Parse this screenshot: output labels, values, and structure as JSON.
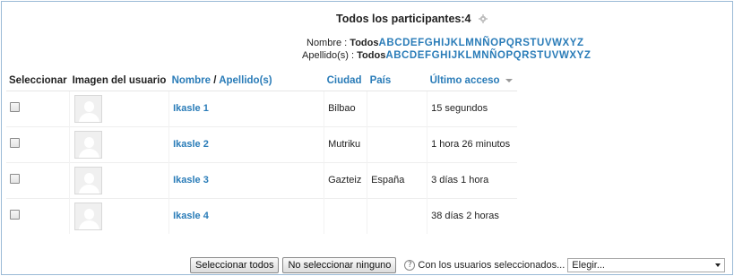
{
  "title": {
    "text": "Todos los participantes:",
    "count": "4"
  },
  "filters": {
    "nombre_label": "Nombre : ",
    "apellido_label": "Apellido(s) : ",
    "todos": "Todos",
    "letters": [
      "A",
      "B",
      "C",
      "D",
      "E",
      "F",
      "G",
      "H",
      "I",
      "J",
      "K",
      "L",
      "M",
      "N",
      "Ñ",
      "O",
      "P",
      "Q",
      "R",
      "S",
      "T",
      "U",
      "V",
      "W",
      "X",
      "Y",
      "Z"
    ]
  },
  "columns": {
    "select": "Seleccionar",
    "image": "Imagen del usuario",
    "nombre": "Nombre",
    "sep": " / ",
    "apellido": "Apellido(s)",
    "ciudad": "Ciudad",
    "pais": "País",
    "acceso": "Último acceso"
  },
  "rows": [
    {
      "name": "Ikasle 1",
      "city": "Bilbao",
      "country": "",
      "last_access": "15 segundos"
    },
    {
      "name": "Ikasle 2",
      "city": "Mutriku",
      "country": "",
      "last_access": "1 hora 26 minutos"
    },
    {
      "name": "Ikasle 3",
      "city": "Gazteiz",
      "country": "España",
      "last_access": "3 días 1 hora"
    },
    {
      "name": "Ikasle 4",
      "city": "",
      "country": "",
      "last_access": "38 días 2 horas"
    }
  ],
  "footer": {
    "select_all": "Seleccionar todos",
    "select_none": "No seleccionar ninguno",
    "help": "?",
    "with_selected": "Con los usuarios seleccionados...",
    "action_select": "Elegir..."
  },
  "colors": {
    "link": "#2a7cb8",
    "border": "#9bbad6"
  }
}
